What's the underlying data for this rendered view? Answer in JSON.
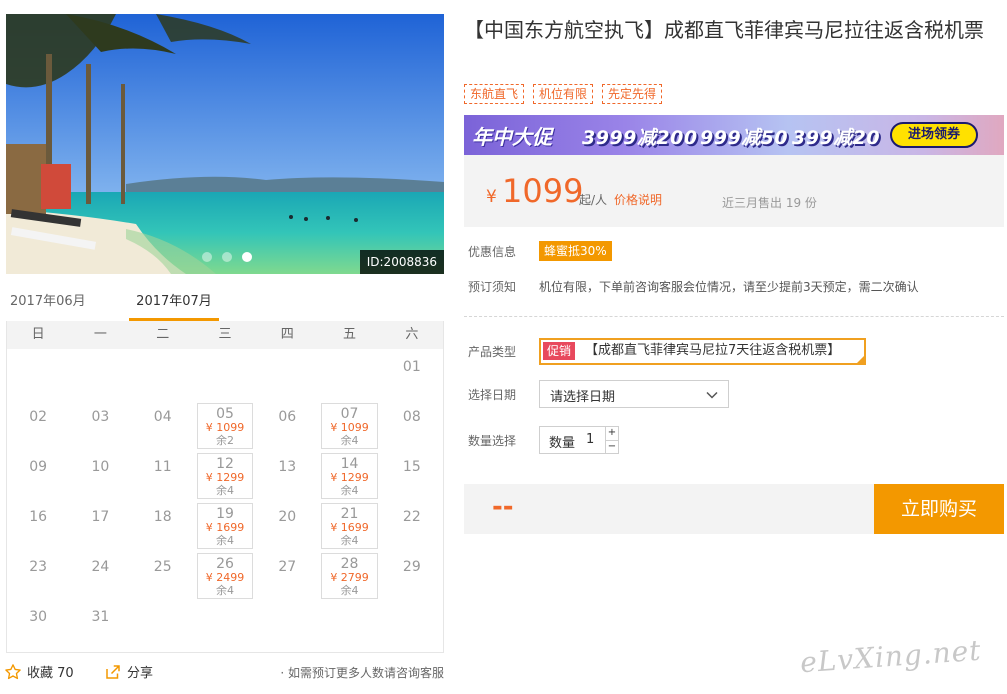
{
  "photo": {
    "id_label": "ID:2008836",
    "slide_count": 3,
    "active_slide": 3
  },
  "months": [
    "2017年06月",
    "2017年07月"
  ],
  "active_month": "2017年07月",
  "weekdays": [
    "日",
    "一",
    "二",
    "三",
    "四",
    "五",
    "六"
  ],
  "calendar": {
    "leading_blank_days": 6,
    "days": [
      {
        "d": "01"
      },
      {
        "d": "02"
      },
      {
        "d": "03"
      },
      {
        "d": "04"
      },
      {
        "d": "05",
        "price": "¥ 1099",
        "left": "余2"
      },
      {
        "d": "06"
      },
      {
        "d": "07",
        "price": "¥ 1099",
        "left": "余4"
      },
      {
        "d": "08"
      },
      {
        "d": "09"
      },
      {
        "d": "10"
      },
      {
        "d": "11"
      },
      {
        "d": "12",
        "price": "¥ 1299",
        "left": "余4"
      },
      {
        "d": "13"
      },
      {
        "d": "14",
        "price": "¥ 1299",
        "left": "余4"
      },
      {
        "d": "15"
      },
      {
        "d": "16"
      },
      {
        "d": "17"
      },
      {
        "d": "18"
      },
      {
        "d": "19",
        "price": "¥ 1699",
        "left": "余4"
      },
      {
        "d": "20"
      },
      {
        "d": "21",
        "price": "¥ 1699",
        "left": "余4"
      },
      {
        "d": "22"
      },
      {
        "d": "23"
      },
      {
        "d": "24"
      },
      {
        "d": "25"
      },
      {
        "d": "26",
        "price": "¥ 2499",
        "left": "余4"
      },
      {
        "d": "27"
      },
      {
        "d": "28",
        "price": "¥ 2799",
        "left": "余4"
      },
      {
        "d": "29"
      },
      {
        "d": "30"
      },
      {
        "d": "31"
      }
    ]
  },
  "share_bar": {
    "fav_label": "收藏 70",
    "share_label": "分享",
    "tip": "· 如需预订更多人数请咨询客服"
  },
  "product": {
    "title": "【中国东方航空执飞】成都直飞菲律宾马尼拉往返含税机票",
    "tags": [
      "东航直飞",
      "机位有限",
      "先定先得"
    ]
  },
  "banner": {
    "main": "年中大促",
    "deals": [
      "3999减200",
      "999减50",
      "399减20"
    ],
    "button": "进场领券"
  },
  "price": {
    "currency": "¥",
    "amount": "1099",
    "from_label": "起/人",
    "note_link": "价格说明",
    "sold": "近三月售出 19 份"
  },
  "info": {
    "discount_label": "优惠信息",
    "discount_badge": "蜂蜜抵30%",
    "notice_label": "预订须知",
    "notice_text": "机位有限，下单前咨询客服会位情况，请至少提前3天预定，需二次确认"
  },
  "form": {
    "type_label": "产品类型",
    "promo_badge": "促销",
    "product_option": "【成都直飞菲律宾马尼拉7天往返含税机票】",
    "date_label": "选择日期",
    "date_placeholder": "请选择日期",
    "qty_label": "数量选择",
    "qty_inline_label": "数量",
    "qty_value": "1",
    "plus": "+",
    "minus": "−"
  },
  "buy": {
    "total": "--",
    "button": "立即购买"
  },
  "watermark": "eLvXing.net",
  "colors": {
    "accent": "#f39800",
    "price": "#f0682a",
    "promo": "#e8495d"
  }
}
